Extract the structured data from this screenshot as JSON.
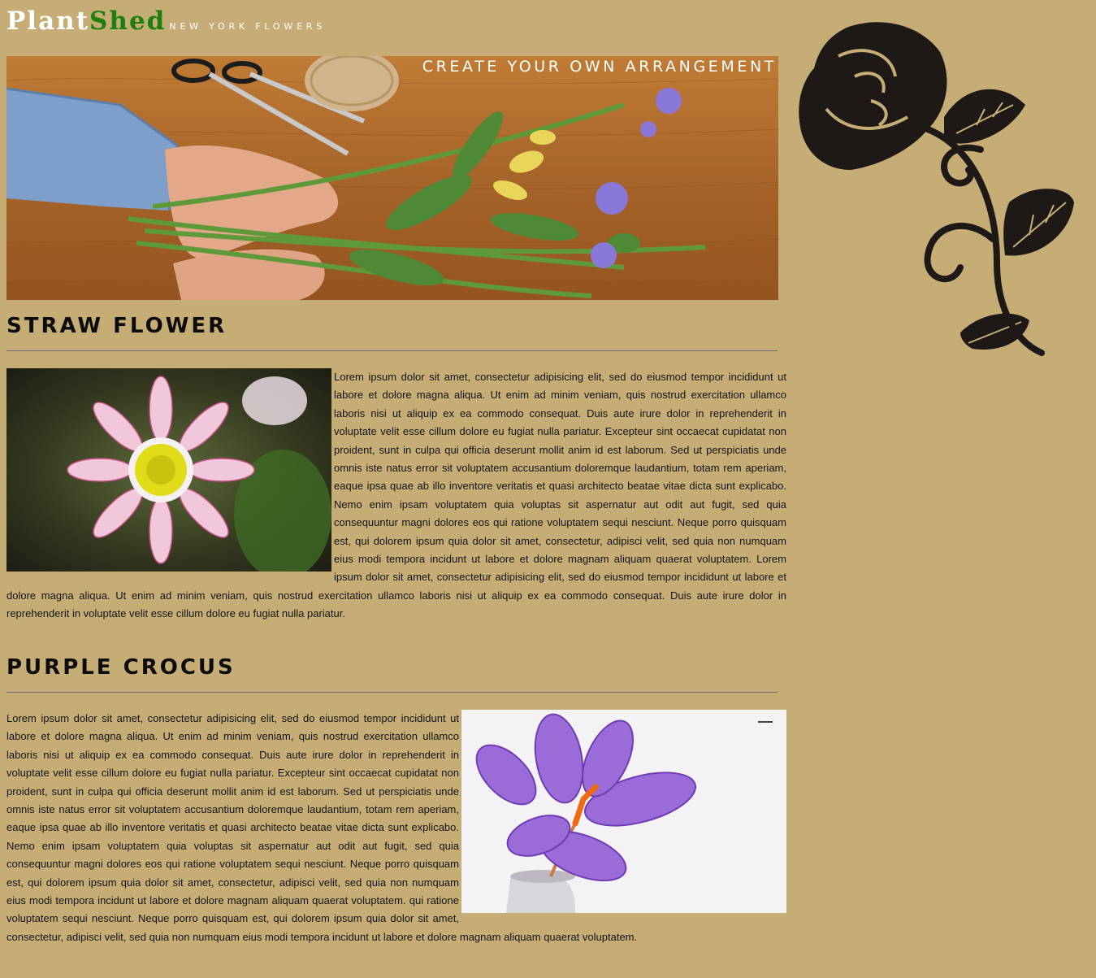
{
  "brand": {
    "name_part1": "Plant",
    "name_part2": "Shed",
    "tagline": "NEW YORK FLOWERS"
  },
  "banner": {
    "caption": "CREATE YOUR OWN ARRANGEMENT"
  },
  "colors": {
    "page_background": "#c6ad76",
    "logo_white": "#ffffff",
    "logo_green": "#1c7f0e",
    "divider": "#6f6a74"
  },
  "sections": [
    {
      "title": "STRAW FLOWER",
      "image_position": "left",
      "body": "Lorem ipsum dolor sit amet, consectetur adipisicing elit, sed do eiusmod tempor incididunt ut labore et dolore magna aliqua. Ut enim ad minim veniam, quis nostrud exercitation ullamco laboris nisi ut aliquip ex ea commodo consequat. Duis aute irure dolor in reprehenderit in voluptate velit esse cillum dolore eu fugiat nulla pariatur. Excepteur sint occaecat cupidatat non proident, sunt in culpa qui officia deserunt mollit anim id est laborum. Sed ut perspiciatis unde omnis iste natus error sit voluptatem accusantium doloremque laudantium, totam rem aperiam, eaque ipsa quae ab illo inventore veritatis et quasi architecto beatae vitae dicta sunt explicabo. Nemo enim ipsam voluptatem quia voluptas sit aspernatur aut odit aut fugit, sed quia consequuntur magni dolores eos qui ratione voluptatem sequi nesciunt. Neque porro quisquam est, qui dolorem ipsum quia dolor sit amet, consectetur, adipisci velit, sed quia non numquam eius modi tempora incidunt ut labore et dolore magnam aliquam quaerat voluptatem. Lorem ipsum dolor sit amet, consectetur adipisicing elit, sed do eiusmod tempor incididunt ut labore et dolore magna aliqua. Ut enim ad minim veniam, quis nostrud exercitation ullamco laboris nisi ut aliquip ex ea commodo consequat. Duis aute irure dolor in reprehenderit in voluptate velit esse cillum dolore eu fugiat nulla pariatur."
    },
    {
      "title": "PURPLE CROCUS",
      "image_position": "right",
      "body": "Lorem ipsum dolor sit amet, consectetur adipisicing elit, sed do eiusmod tempor incididunt ut labore et dolore magna aliqua. Ut enim ad minim veniam, quis nostrud exercitation ullamco laboris nisi ut aliquip ex ea commodo consequat. Duis aute irure dolor in reprehenderit in voluptate velit esse cillum dolore eu fugiat nulla pariatur. Excepteur sint occaecat cupidatat non proident, sunt in culpa qui officia deserunt mollit anim id est laborum. Sed ut perspiciatis unde omnis iste natus error sit voluptatem accusantium doloremque laudantium, totam rem aperiam, eaque ipsa quae ab illo inventore veritatis et quasi architecto beatae vitae dicta sunt explicabo. Nemo enim ipsam voluptatem quia voluptas sit aspernatur aut odit aut fugit, sed quia consequuntur magni dolores eos qui ratione voluptatem sequi nesciunt. Neque porro quisquam est, qui dolorem ipsum quia dolor sit amet, consectetur, adipisci velit, sed quia non numquam eius modi tempora incidunt ut labore et dolore magnam aliquam quaerat voluptatem. qui ratione voluptatem sequi nesciunt. Neque porro quisquam est, qui dolorem ipsum quia dolor sit amet, consectetur, adipisci velit, sed quia non numquam eius modi tempora incidunt ut labore et dolore magnam aliquam quaerat voluptatem."
    }
  ]
}
